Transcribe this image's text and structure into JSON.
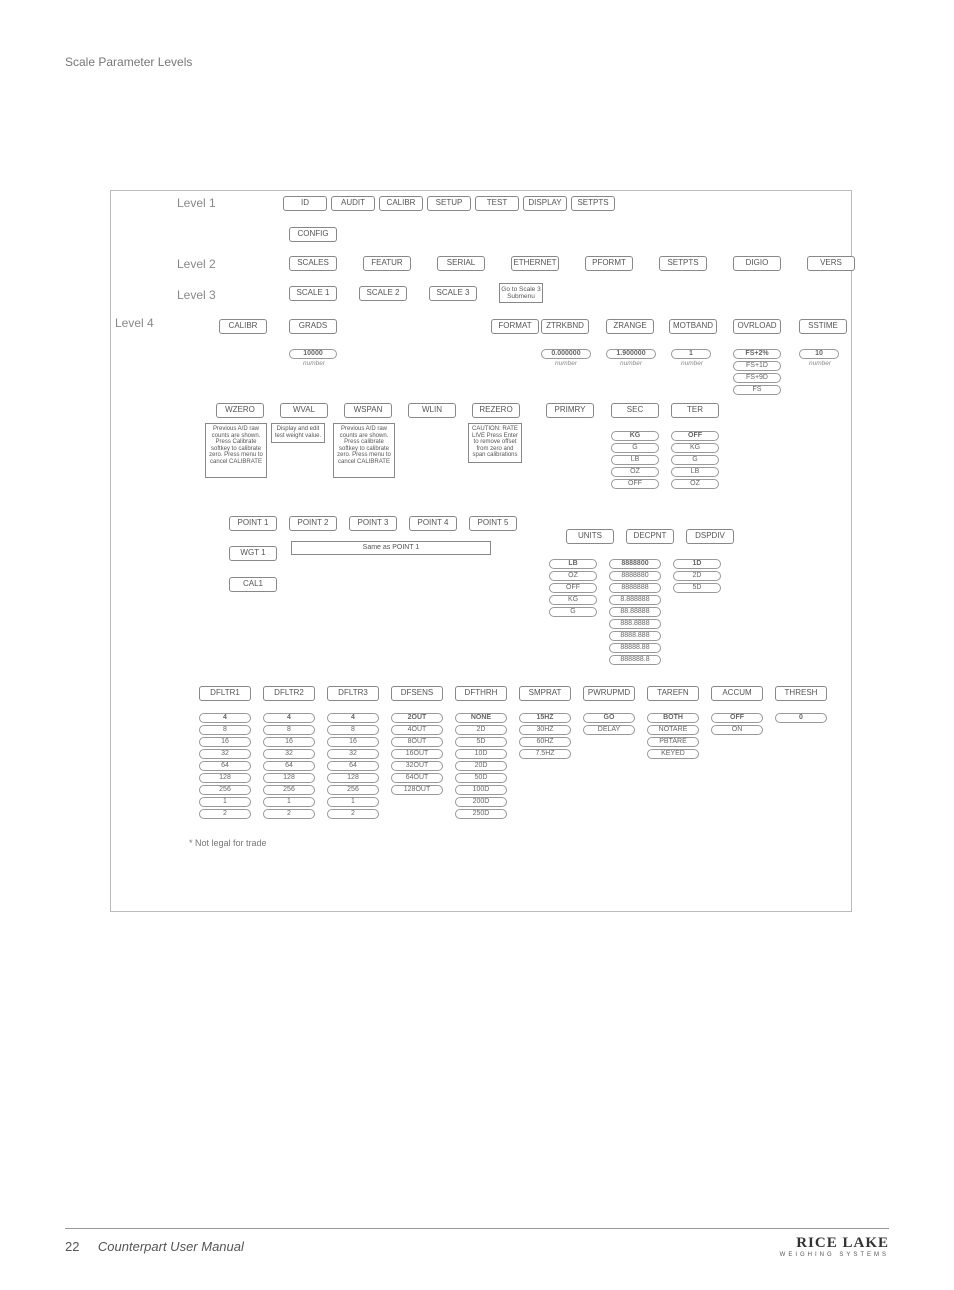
{
  "page": {
    "number": "22",
    "title": "Counterpart User Manual",
    "logo": "RICE LAKE",
    "logo_sub": "WEIGHING SYSTEMS"
  },
  "diagram": {
    "heading": "Scale Parameter Levels",
    "footnote": "* Not legal for trade",
    "levels": {
      "l1": "Level 1",
      "l2": "Level 2",
      "l3": "Level 3",
      "l4": "Level 4"
    },
    "level1": [
      "ID",
      "AUDIT",
      "CALIBR",
      "SETUP",
      "TEST",
      "DISPLAY",
      "SETPTS"
    ],
    "config": "CONFIG",
    "level2": [
      "SCALES",
      "FEATUR",
      "SERIAL",
      "ETHERNET",
      "PFORMT",
      "SETPTS",
      "DIGIO",
      "VERS"
    ],
    "level3": [
      "SCALE 1",
      "SCALE 2",
      "SCALE 3"
    ],
    "l3_note": "Go to Scale 3 Submenu",
    "level4_row1": [
      "CALIBR",
      "GRADS",
      "FORMAT",
      "ZTRKBND",
      "ZRANGE",
      "MOTBAND",
      "OVRLOAD",
      "SSTIME"
    ],
    "grads_val": "10000",
    "grads_cap": "number",
    "ztrkbnd_val": "0.000000",
    "ztrkbnd_cap": "number",
    "zrange_val": "1.900000",
    "zrange_cap": "number",
    "motband_val": "1",
    "motband_cap": "number",
    "ovrload_opts": [
      "FS+2%",
      "FS+1D",
      "FS+9D",
      "FS"
    ],
    "sstime_val": "10",
    "sstime_cap": "number",
    "calibr_row": [
      "WZERO",
      "WVAL",
      "WSPAN",
      "WLIN",
      "REZERO"
    ],
    "wzero_desc": "Previous A/D raw counts are shown. Press Calibrate softkey to calibrate zero. Press menu to cancel CALIBRATE",
    "wval_desc": "Display and edit test weight value.",
    "wspan_desc": "Previous A/D raw counts are shown. Press calibrate softkey to calibrate zero. Press menu to cancel CALIBRATE",
    "rezero_desc": "CAUTION: RATE LIVE Press Enter to remove offset from zero and span calibrations",
    "format_row": [
      "PRIMRY",
      "SEC",
      "TER"
    ],
    "sec_opts": [
      "KG",
      "G",
      "LB",
      "OZ",
      "OFF"
    ],
    "ter_opts": [
      "OFF",
      "KG",
      "G",
      "LB",
      "OZ"
    ],
    "wlin_row": [
      "POINT 1",
      "POINT 2",
      "POINT 3",
      "POINT 4",
      "POINT 5"
    ],
    "wgt1": "WGT 1",
    "cal1": "CAL1",
    "same_note": "Same as POINT 1",
    "primry_row": [
      "UNITS",
      "DECPNT",
      "DSPDIV"
    ],
    "units_opts": [
      "LB",
      "OZ",
      "OFF",
      "KG",
      "G"
    ],
    "decpnt_opts": [
      "8888800",
      "8888880",
      "8888888",
      "8.888888",
      "88.88888",
      "888.8888",
      "8888.888",
      "88888.88",
      "888888.8"
    ],
    "dspdiv_opts": [
      "1D",
      "2D",
      "5D"
    ],
    "bottom_row": [
      "DFLTR1",
      "DFLTR2",
      "DFLTR3",
      "DFSENS",
      "DFTHRH",
      "SMPRAT",
      "PWRUPMD",
      "TAREFN",
      "ACCUM",
      "THRESH"
    ],
    "dfltr_opts": [
      "4",
      "8",
      "16",
      "32",
      "64",
      "128",
      "256",
      "1",
      "2"
    ],
    "dfsens_opts": [
      "2OUT",
      "4OUT",
      "8OUT",
      "16OUT",
      "32OUT",
      "64OUT",
      "128OUT"
    ],
    "dfthrh_opts": [
      "NONE",
      "2D",
      "5D",
      "10D",
      "20D",
      "50D",
      "100D",
      "200D",
      "250D"
    ],
    "smprat_opts": [
      "15HZ",
      "30HZ",
      "60HZ",
      "7.5HZ"
    ],
    "pwrupmd_opts": [
      "GO",
      "DELAY"
    ],
    "tarefn_opts": [
      "BOTH",
      "NOTARE",
      "PBTARE",
      "KEYED"
    ],
    "accum_opts": [
      "OFF",
      "ON"
    ],
    "thresh_opts": [
      "0"
    ]
  }
}
